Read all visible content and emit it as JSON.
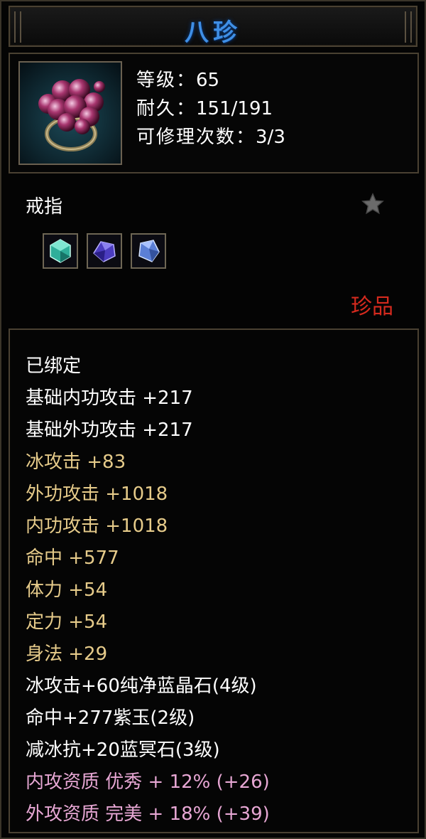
{
  "title": "八珍",
  "header": {
    "level_label": "等级：",
    "level_value": "65",
    "durability_label": "耐久：",
    "durability_value": "151/191",
    "repair_label": "可修理次数：",
    "repair_value": "3/3"
  },
  "item_type": "戒指",
  "rarity": "珍品",
  "icons": {
    "item": "ring-icon",
    "favorite": "star-icon",
    "gems": [
      "green-gem-icon",
      "purple-gem-icon",
      "blue-gem-icon"
    ]
  },
  "colors": {
    "title": "#3f8fe6",
    "white_text": "#ffffff",
    "gold_text": "#e6cb8a",
    "pink_text": "#e7a7d4",
    "rarity": "#d52a1e"
  },
  "attributes": [
    "已绑定",
    "基础内功攻击 +217",
    "基础外功攻击 +217",
    "冰攻击 +83",
    "外功攻击 +1018",
    "内功攻击 +1018",
    "命中 +577",
    "体力 +54",
    "定力 +54",
    "身法 +29",
    "冰攻击+60纯净蓝晶石(4级)",
    "命中+277紫玉(2级)",
    "减冰抗+20蓝冥石(3级)",
    "内攻资质 优秀 + 12% (+26)",
    "外攻资质 完美 + 18% (+39)"
  ]
}
